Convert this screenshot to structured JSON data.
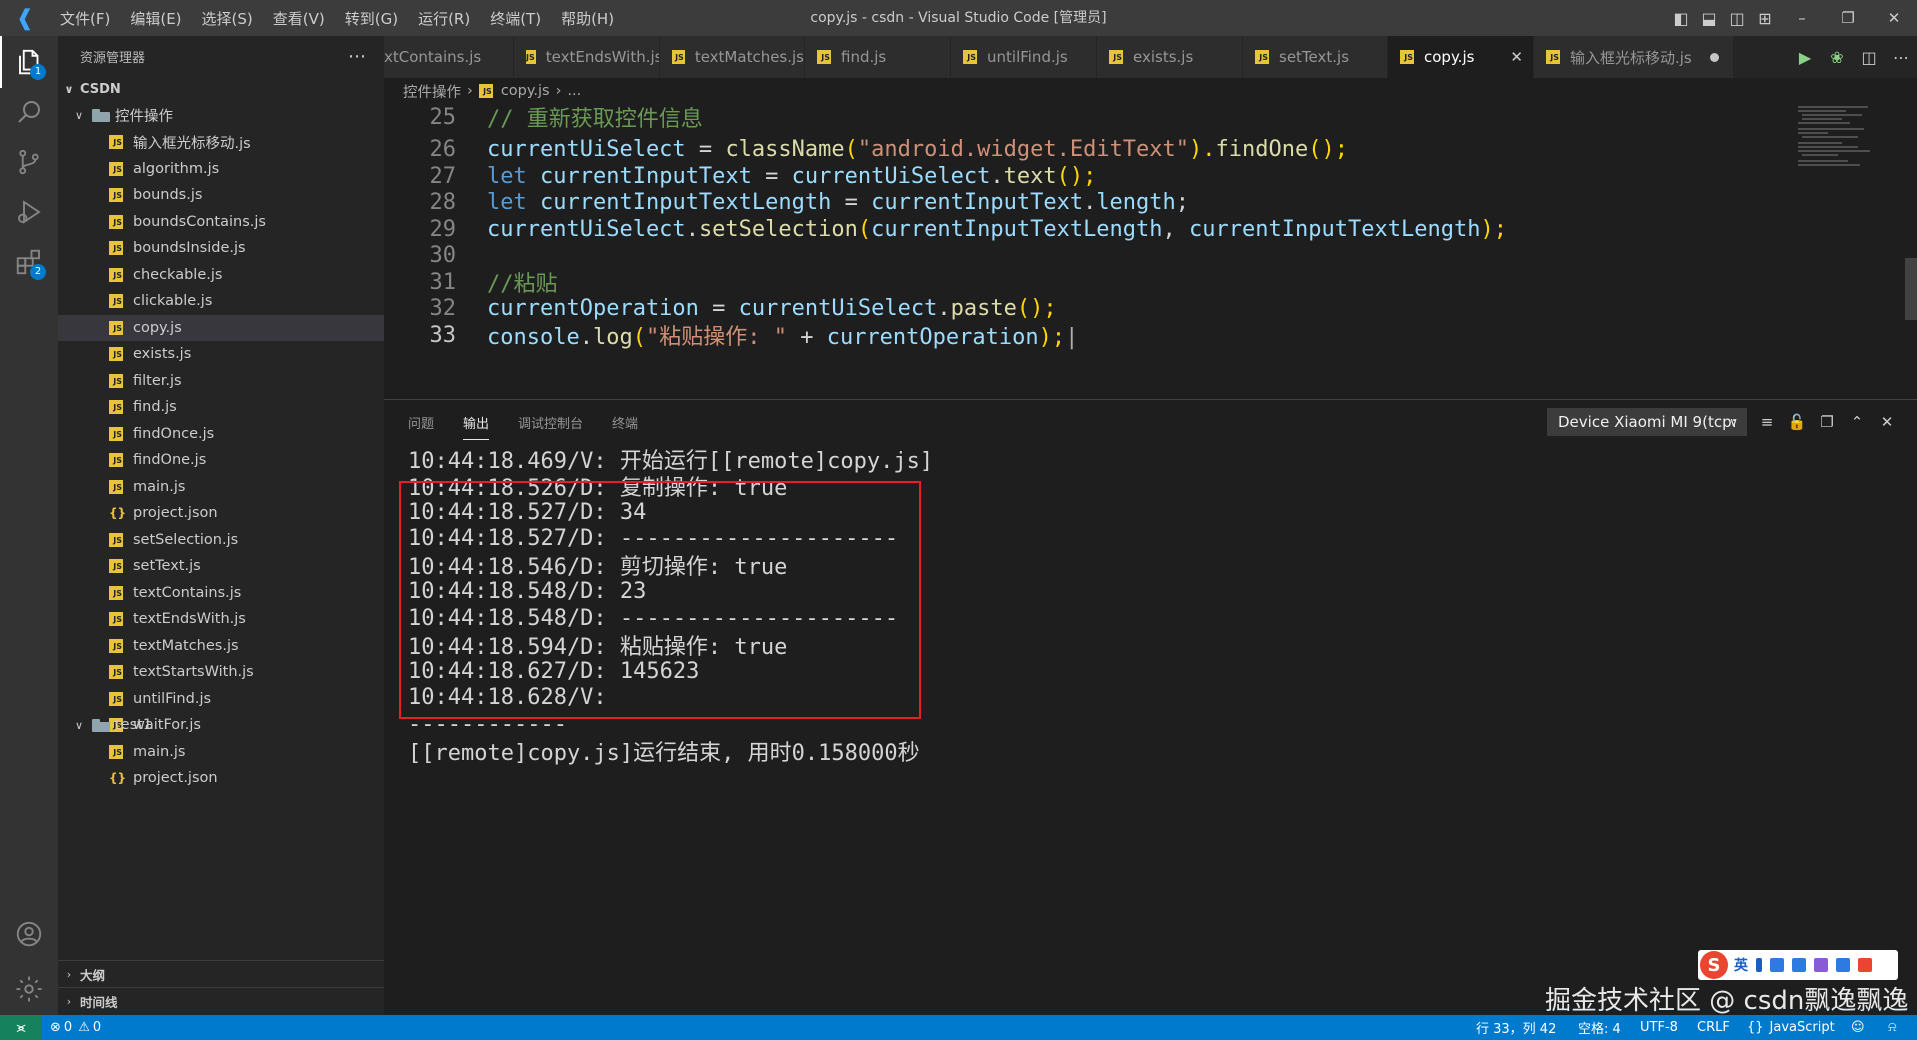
{
  "titlebar": {
    "menus": [
      "文件(F)",
      "编辑(E)",
      "选择(S)",
      "查看(V)",
      "转到(G)",
      "运行(R)",
      "终端(T)",
      "帮助(H)"
    ],
    "title": "copy.js - csdn - Visual Studio Code [管理员]"
  },
  "activity_badges": {
    "explorer": "1",
    "extensions": "2"
  },
  "sidebar": {
    "header": "资源管理器",
    "root": "CSDN",
    "folder1": "控件操作",
    "files": [
      "输入框光标移动.js",
      "algorithm.js",
      "bounds.js",
      "boundsContains.js",
      "boundsInside.js",
      "checkable.js",
      "clickable.js",
      "copy.js",
      "exists.js",
      "filter.js",
      "find.js",
      "findOnce.js",
      "findOne.js",
      "main.js",
      "project.json",
      "setSelection.js",
      "setText.js",
      "textContains.js",
      "textEndsWith.js",
      "textMatches.js",
      "textStartsWith.js",
      "untilFind.js",
      "waitFor.js"
    ],
    "folder2": "test1",
    "files2": [
      "main.js",
      "project.json"
    ],
    "outline": "大纲",
    "timeline": "时间线"
  },
  "tabs": [
    "xtContains.js",
    "textEndsWith.js",
    "textMatches.js",
    "find.js",
    "untilFind.js",
    "exists.js",
    "setText.js",
    "copy.js",
    "输入框光标移动.js"
  ],
  "breadcrumb": {
    "folder": "控件操作",
    "file": "copy.js",
    "more": "..."
  },
  "code": {
    "line_numbers": [
      "25",
      "26",
      "27",
      "28",
      "29",
      "30",
      "31",
      "32",
      "33"
    ],
    "l25": "// 重新获取控件信息",
    "l26": {
      "a": "currentUiSelect",
      "b": " = ",
      "c": "className",
      "d": "(",
      "e": "\"android.widget.EditText\"",
      "f": ").",
      "g": "findOne",
      "h": "();"
    },
    "l27": {
      "a": "let",
      "b": " currentInputText",
      "c": " = ",
      "d": "currentUiSelect",
      "e": ".",
      "f": "text",
      "g": "();"
    },
    "l28": {
      "a": "let",
      "b": " currentInputTextLength",
      "c": " = ",
      "d": "currentInputText",
      "e": ".",
      "f": "length",
      "g": ";"
    },
    "l29": {
      "a": "currentUiSelect",
      "b": ".",
      "c": "setSelection",
      "d": "(",
      "e": "currentInputTextLength",
      "f": ", ",
      "g": "currentInputTextLength",
      "h": ");"
    },
    "l31": "//粘贴",
    "l32": {
      "a": "currentOperation",
      "b": " = ",
      "c": "currentUiSelect",
      "d": ".",
      "e": "paste",
      "f": "();"
    },
    "l33": {
      "a": "console",
      "b": ".",
      "c": "log",
      "d": "(",
      "e": "\"粘贴操作: \"",
      "f": " + ",
      "g": "currentOperation",
      "h": ");"
    }
  },
  "panel": {
    "tabs": [
      "问题",
      "输出",
      "调试控制台",
      "终端"
    ],
    "device": "Device Xiaomi MI 9(tcp:",
    "output": [
      "10:44:18.469/V: 开始运行[[remote]copy.js]",
      "10:44:18.526/D: 复制操作: true",
      "10:44:18.527/D: 34",
      "10:44:18.527/D: ---------------------",
      "10:44:18.546/D: 剪切操作: true",
      "10:44:18.548/D: 23",
      "10:44:18.548/D: ---------------------",
      "10:44:18.594/D: 粘贴操作: true",
      "10:44:18.627/D: 145623",
      "10:44:18.628/V: ",
      "------------",
      "[[remote]copy.js]运行结束, 用时0.158000秒"
    ]
  },
  "ime": {
    "label": "英"
  },
  "watermark": "掘金技术社区 @ csdn飘逸飘逸",
  "statusbar": {
    "errors": "0",
    "warnings": "0",
    "position": "行 33，列 42",
    "spaces": "空格: 4",
    "encoding": "UTF-8",
    "eol": "CRLF",
    "language": "JavaScript"
  },
  "colors": {
    "accent": "#007acc",
    "highlight_box": "#e81e25",
    "remote": "#16825d"
  }
}
